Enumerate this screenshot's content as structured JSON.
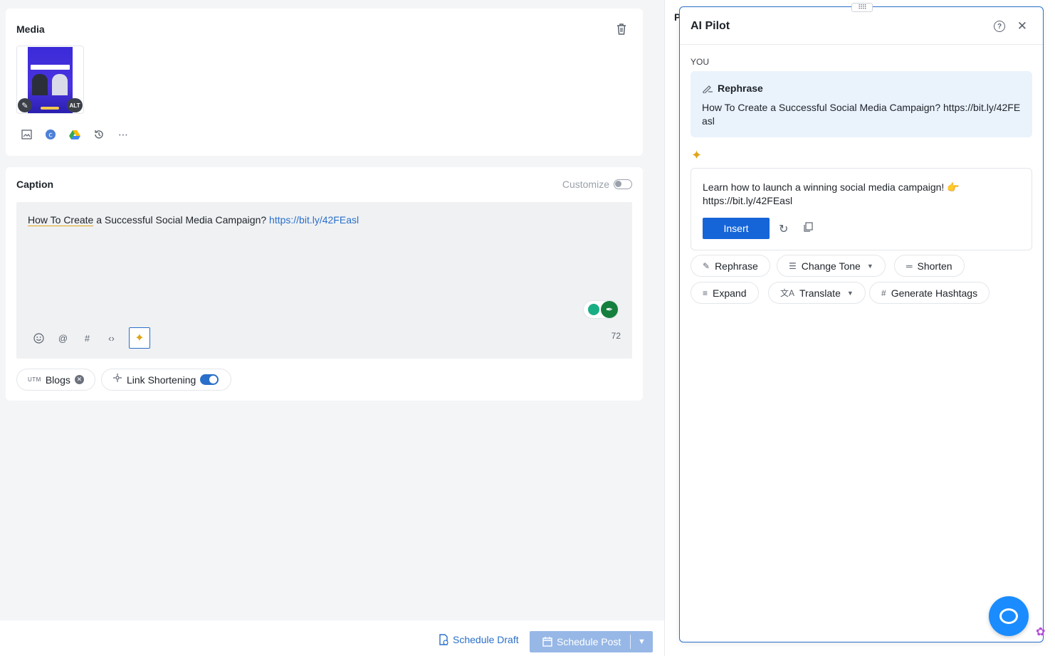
{
  "media": {
    "title": "Media",
    "alt_badge": "ALT",
    "tools": [
      "image-icon",
      "canva-icon",
      "google-drive-icon",
      "history-icon",
      "more-icon"
    ]
  },
  "caption": {
    "title": "Caption",
    "customize_label": "Customize",
    "text_underlined": "How To Create",
    "text_plain": " a Successful Social Media Campaign? ",
    "text_link": "https://bit.ly/42FEasl",
    "char_count": "72",
    "chips": {
      "utm_prefix": "UTM",
      "utm_label": "Blogs",
      "link_shortening_label": "Link Shortening"
    }
  },
  "bottom": {
    "schedule_draft": "Schedule Draft",
    "schedule_post": "Schedule Post"
  },
  "right_peek_letter": "P",
  "ai_pilot": {
    "title": "AI Pilot",
    "you_label": "YOU",
    "request_action": "Rephrase",
    "request_text": "How To Create a Successful Social Media Campaign? https://bit.ly/42FEasl",
    "response_text": "Learn how to launch a winning social media campaign! 👉 https://bit.ly/42FEasl",
    "insert_label": "Insert",
    "actions": {
      "rephrase": "Rephrase",
      "change_tone": "Change Tone",
      "shorten": "Shorten",
      "expand": "Expand",
      "translate": "Translate",
      "generate_hashtags": "Generate Hashtags"
    }
  },
  "colors": {
    "accent": "#1565d8",
    "link": "#2a6fc9",
    "schedule_post_bg": "#97b7e6",
    "you_box_bg": "#eaf2fc",
    "chat_launcher": "#1a8cff"
  }
}
